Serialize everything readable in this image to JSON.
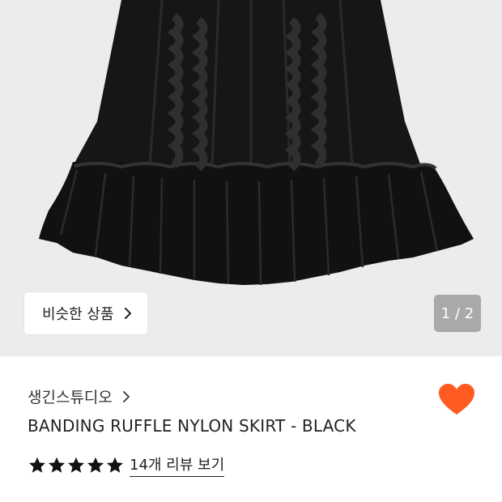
{
  "gallery": {
    "similar_button_label": "비슷한 상품",
    "pager_text": "1 / 2",
    "image_icon": "black-ruffle-skirt-photo"
  },
  "product": {
    "brand": "생긴스튜디오",
    "title": "BANDING RUFFLE NYLON SKIRT - BLACK",
    "rating_stars": 5,
    "review_link": "14개 리뷰 보기",
    "favorite_icon": "heart-icon",
    "favorite_active": true
  },
  "colors": {
    "gallery_bg": "#ececec",
    "heart": "#ff5a1f",
    "pager_bg": "#a9a9a9",
    "skirt": "#141414"
  }
}
